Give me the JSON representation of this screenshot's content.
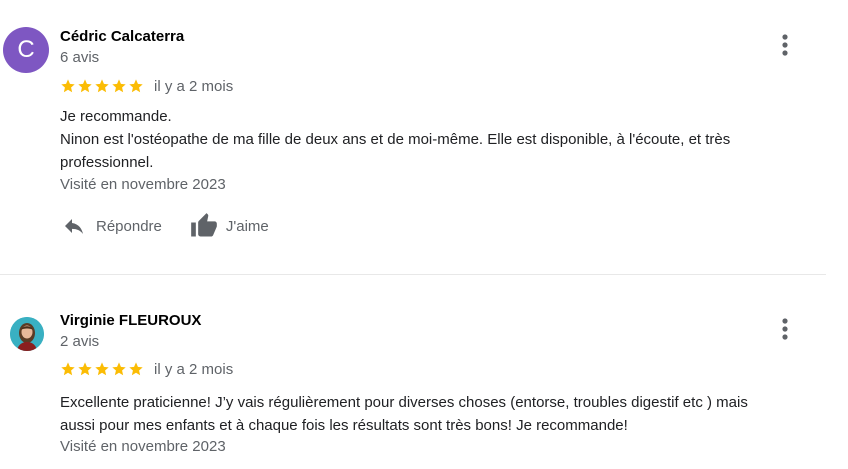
{
  "reviews": [
    {
      "avatar_letter": "C",
      "avatar_color": "#7e57c2",
      "name": "Cédric Calcaterra",
      "review_count": "6 avis",
      "rating": 5,
      "date": "il y a 2 mois",
      "text_lines": [
        "Je recommande.",
        "Ninon est l'ostéopathe de ma fille de deux ans et de moi-même. Elle est disponible, à l'écoute, et très",
        "professionnel."
      ],
      "visited": "Visité en novembre 2023",
      "reply_label": "Répondre",
      "like_label": "J'aime",
      "menu_icon": "more-vert-icon"
    },
    {
      "avatar_icon": "profile-photo-avatar",
      "name": "Virginie FLEUROUX",
      "review_count": "2 avis",
      "rating": 5,
      "date": "il y a 2 mois",
      "text_lines": [
        "Excellente praticienne! J’y vais régulièrement pour diverses choses (entorse, troubles digestif etc ) mais",
        "aussi pour mes enfants et à chaque fois les résultats sont très bons! Je recommande!"
      ],
      "visited": "Visité en novembre 2023",
      "menu_icon": "more-vert-icon"
    }
  ],
  "colors": {
    "star": "#fbbc04",
    "secondary_text": "#5f6368",
    "divider": "#e8e8e8"
  }
}
